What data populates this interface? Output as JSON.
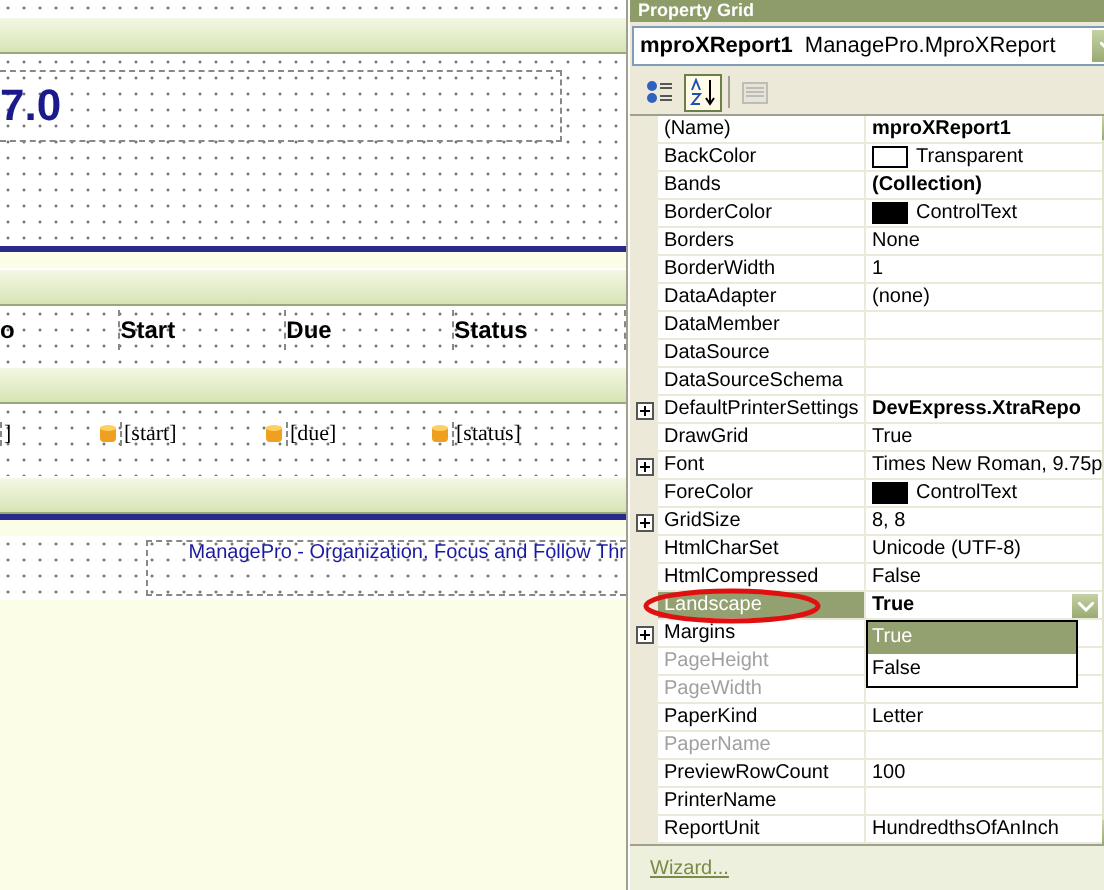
{
  "designer": {
    "sections": [
      {
        "kind": "strip"
      },
      {
        "kind": "band"
      },
      {
        "kind": "title",
        "text": "7.0"
      },
      {
        "kind": "rule"
      },
      {
        "kind": "band"
      },
      {
        "kind": "header",
        "cells": [
          "o",
          "Start",
          "Due",
          "Status"
        ]
      },
      {
        "kind": "band"
      },
      {
        "kind": "detail",
        "cells": [
          {
            "text": "]",
            "icon": false
          },
          {
            "text": "[start]",
            "icon": true
          },
          {
            "text": "[due]",
            "icon": true
          },
          {
            "text": "[status]",
            "icon": true
          }
        ]
      },
      {
        "kind": "band"
      },
      {
        "kind": "rule"
      },
      {
        "kind": "footer",
        "text": "ManagePro - Organization, Focus and Follow Thr"
      }
    ]
  },
  "property_grid": {
    "title": "Property Grid",
    "object_name": "mproXReport1",
    "object_type": "ManagePro.MproXReport",
    "toolbar": [
      {
        "kind": "categorized",
        "selected": false
      },
      {
        "kind": "alphabetical",
        "selected": true
      },
      {
        "kind": "pages",
        "disabled": true
      }
    ],
    "rows": [
      {
        "name": "(Name)",
        "value": "mproXReport1",
        "bold": true
      },
      {
        "name": "BackColor",
        "value": "Transparent",
        "color": "#ffffff"
      },
      {
        "name": "Bands",
        "value": "(Collection)",
        "bold": true
      },
      {
        "name": "BorderColor",
        "value": "ControlText",
        "color": "#000000"
      },
      {
        "name": "Borders",
        "value": "None"
      },
      {
        "name": "BorderWidth",
        "value": "1"
      },
      {
        "name": "DataAdapter",
        "value": "(none)"
      },
      {
        "name": "DataMember"
      },
      {
        "name": "DataSource"
      },
      {
        "name": "DataSourceSchema"
      },
      {
        "name": "DefaultPrinterSettings",
        "value": "DevExpress.XtraRepo",
        "bold": true,
        "expandable": true
      },
      {
        "name": "DrawGrid",
        "value": "True"
      },
      {
        "name": "Font",
        "value": "Times New Roman, 9.75p",
        "expandable": true
      },
      {
        "name": "ForeColor",
        "value": "ControlText",
        "color": "#000000"
      },
      {
        "name": "GridSize",
        "value": "8, 8",
        "expandable": true
      },
      {
        "name": "HtmlCharSet",
        "value": "Unicode (UTF-8)"
      },
      {
        "name": "HtmlCompressed",
        "value": "False"
      },
      {
        "name": "Landscape",
        "value": "True",
        "bold": true,
        "selected": true,
        "highlighted": true,
        "dropdown": {
          "options": [
            {
              "label": "True",
              "selected": true
            },
            {
              "label": "False",
              "selected": false
            }
          ]
        }
      },
      {
        "name": "Margins",
        "expandable": true
      },
      {
        "name": "PageHeight",
        "disabled": true
      },
      {
        "name": "PageWidth",
        "disabled": true
      },
      {
        "name": "PaperKind",
        "value": "Letter"
      },
      {
        "name": "PaperName",
        "disabled": true
      },
      {
        "name": "PreviewRowCount",
        "value": "100"
      },
      {
        "name": "PrinterName"
      },
      {
        "name": "ReportUnit",
        "value": "HundredthsOfAnInch"
      }
    ],
    "wizard_link": "Wizard..."
  }
}
